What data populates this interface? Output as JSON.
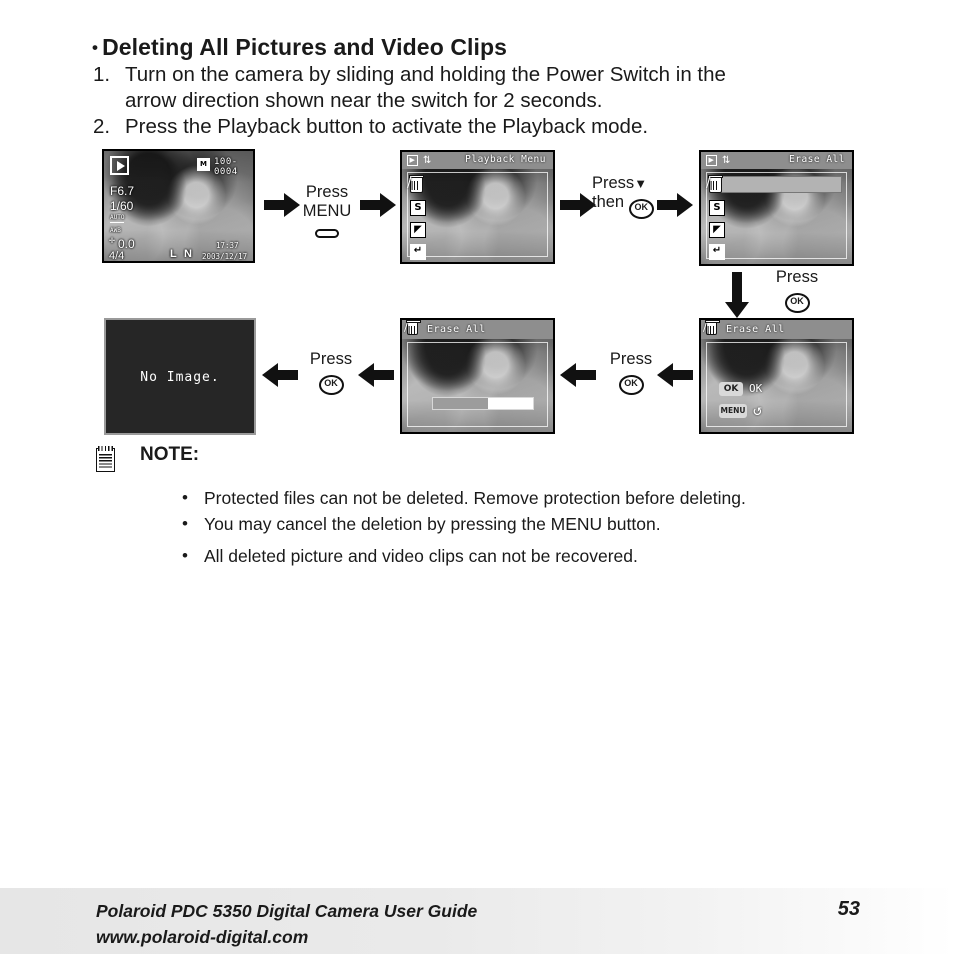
{
  "heading": {
    "bullet": "•",
    "text": "Deleting All Pictures and Video Clips"
  },
  "steps": [
    {
      "num": "1.",
      "line1": "Turn on the camera by sliding and holding the Power Switch in the",
      "line2": "arrow direction shown near the switch for 2 seconds."
    },
    {
      "num": "2.",
      "line1": "Press the Playback button to activate the Playback mode.",
      "line2": ""
    }
  ],
  "screens": {
    "playback_view": {
      "name": "playback-view",
      "file_number": "100-0004",
      "aperture": "F6.7",
      "shutter": "1/60",
      "iso": "AUTO",
      "white_balance": "AWB",
      "exposure_comp": "0.0",
      "frame_counter": "4/4",
      "time": "17:37",
      "date": "2003/12/17",
      "quality_size": "L",
      "quality_mode": "N"
    },
    "playback_menu": {
      "title": "Playback Menu",
      "items": [
        {
          "label": "erase-all",
          "icon": "trash-slash-icon"
        },
        {
          "label": "slide-show",
          "icon": "s-icon"
        },
        {
          "label": "dpof-print",
          "icon": "print-icon"
        },
        {
          "label": "exit",
          "icon": "return-arrow-icon"
        }
      ]
    },
    "erase_all_selected": {
      "title": "Erase All",
      "selected_item": "erase-all"
    },
    "erase_all_confirm": {
      "title": "Erase All",
      "ok_chip": "OK",
      "ok_label": "OK",
      "menu_chip": "MENU",
      "menu_label": "↺"
    },
    "erase_all_progress": {
      "title": "Erase All",
      "progress_percent": 55
    },
    "no_image": {
      "message": "No Image."
    }
  },
  "transitions": {
    "press_menu": {
      "line1": "Press",
      "line2": "MENU",
      "glyph": "menu-button-pill"
    },
    "press_down_then_ok": {
      "line1": "Press",
      "arrow": "▼",
      "line2": "then",
      "ok": "OK"
    },
    "press_ok_vertical": {
      "line1": "Press",
      "ok": "OK"
    },
    "press_ok_right": {
      "line1": "Press",
      "ok": "OK"
    },
    "press_ok_left": {
      "line1": "Press",
      "ok": "OK"
    }
  },
  "note": {
    "title": "NOTE:",
    "items": [
      "Protected files can not be deleted. Remove protection before deleting.",
      "You may cancel the deletion by pressing the MENU button.",
      "All deleted picture and video clips can not be recovered."
    ]
  },
  "footer": {
    "line1": "Polaroid PDC 5350 Digital Camera User Guide",
    "line2": "www.polaroid-digital.com",
    "page_number": "53"
  }
}
